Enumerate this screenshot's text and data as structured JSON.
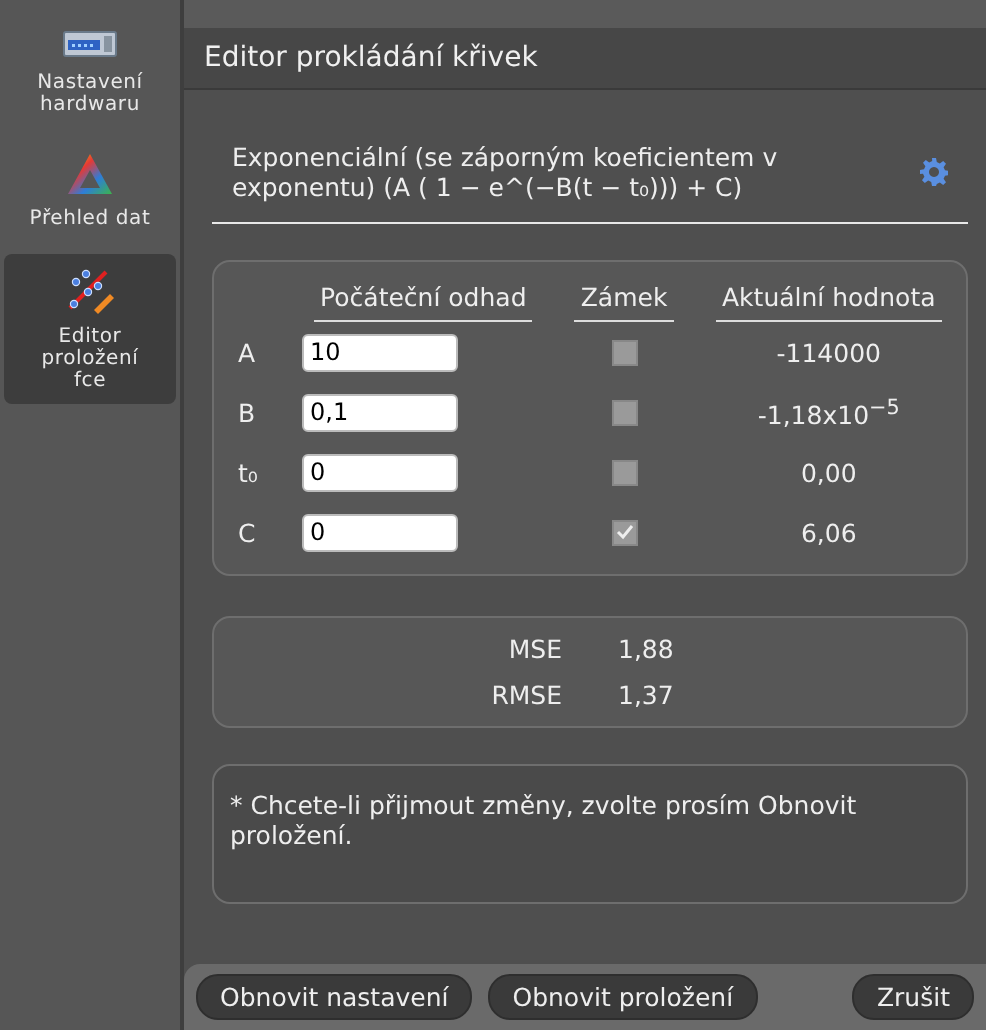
{
  "sidebar": {
    "items": [
      {
        "label": "Nastavení hardwaru",
        "selected": false
      },
      {
        "label": "Přehled dat",
        "selected": false
      },
      {
        "label": "Editor proložení fce",
        "selected": true
      }
    ]
  },
  "window": {
    "title": "Editor prokládání křivek"
  },
  "model": {
    "description": "Exponenciální (se záporným koeficientem v exponentu) (A ( 1 − e^(−B(t − t₀))) + C)"
  },
  "parameters": {
    "columns": [
      "Počáteční odhad",
      "Zámek",
      "Aktuální hodnota"
    ],
    "rows": [
      {
        "name": "A",
        "initial_guess": "10",
        "locked": false,
        "current_value": "-114000"
      },
      {
        "name": "B",
        "initial_guess": "0,1",
        "locked": false,
        "current_value": "-1,18x10$^{−5}$"
      },
      {
        "name": "t₀",
        "initial_guess": "0",
        "locked": false,
        "current_value": "0,00"
      },
      {
        "name": "C",
        "initial_guess": "0",
        "locked": true,
        "current_value": "6,06"
      }
    ]
  },
  "statistics": [
    {
      "label": "MSE",
      "value": "1,88"
    },
    {
      "label": "RMSE",
      "value": "1,37"
    }
  ],
  "note": "* Chcete-li přijmout změny, zvolte prosím Obnovit proložení.",
  "buttons": [
    {
      "label": "Obnovit nastavení"
    },
    {
      "label": "Obnovit proložení"
    },
    {
      "label": "Zrušit"
    }
  ]
}
